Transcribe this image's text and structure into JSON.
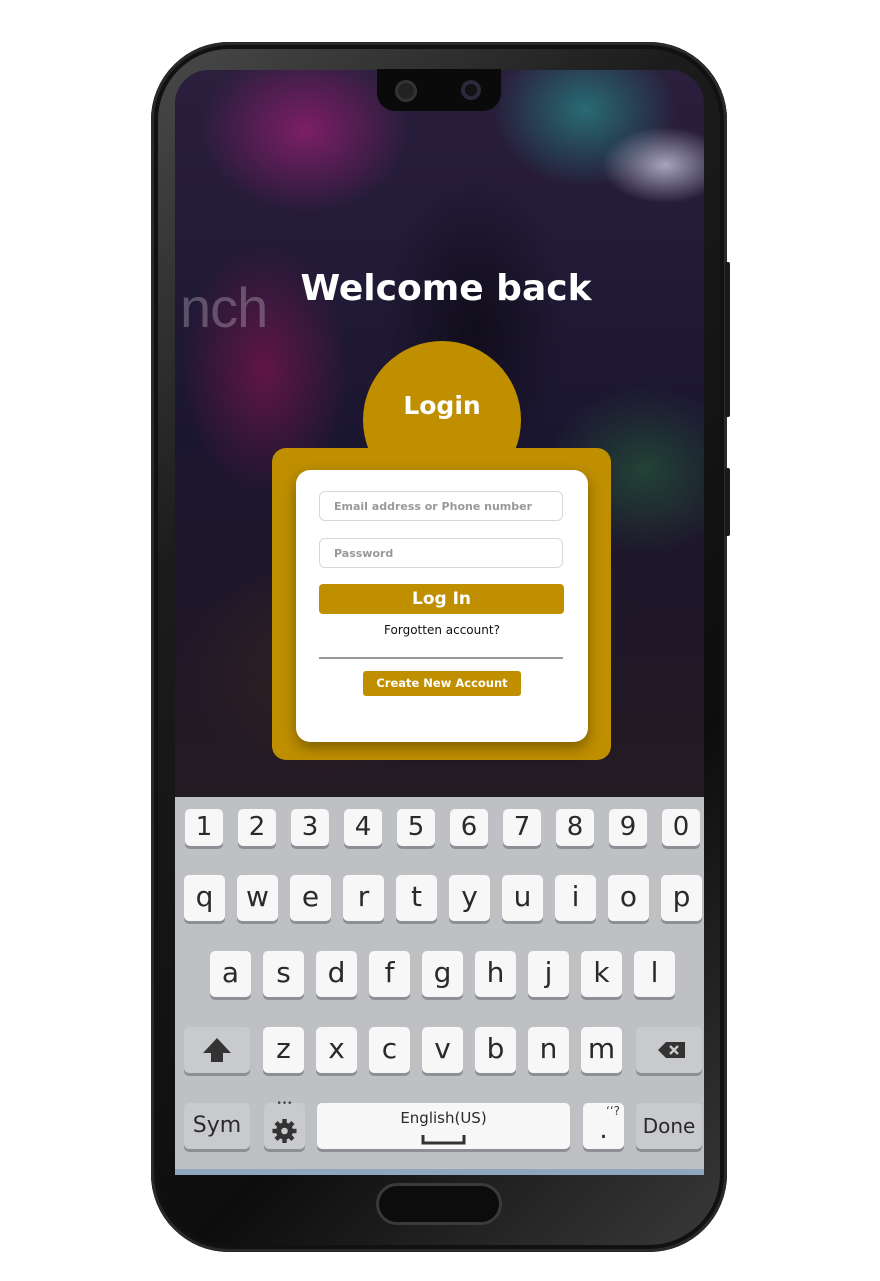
{
  "app": {
    "welcome": "Welcome back",
    "login_heading": "Login",
    "background_text": "nch"
  },
  "form": {
    "email_placeholder": "Email address or Phone number",
    "password_placeholder": "Password",
    "login_button": "Log In",
    "forgot_link": "Forgotten account?",
    "create_button": "Create New Account"
  },
  "keyboard": {
    "numbers": [
      "1",
      "2",
      "3",
      "4",
      "5",
      "6",
      "7",
      "8",
      "9",
      "0"
    ],
    "row1": [
      "q",
      "w",
      "e",
      "r",
      "t",
      "y",
      "u",
      "i",
      "o",
      "p"
    ],
    "row2": [
      "a",
      "s",
      "d",
      "f",
      "g",
      "h",
      "j",
      "k",
      "l"
    ],
    "row3": [
      "z",
      "x",
      "c",
      "v",
      "b",
      "n",
      "m"
    ],
    "sym_key": "Sym",
    "space_label": "English(US)",
    "punct_key": ".",
    "punct_hint": "‘‘?",
    "done_key": "Done",
    "settings_dots": "•••"
  },
  "colors": {
    "accent": "#bf8f00",
    "card": "#ffffff",
    "keyboard_bg": "#bfc0c4"
  }
}
